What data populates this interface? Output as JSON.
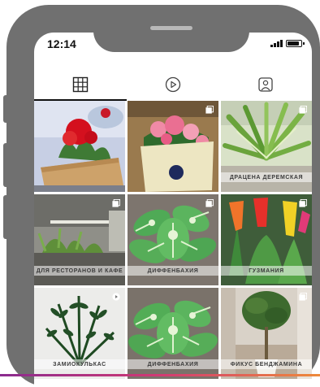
{
  "status_bar": {
    "time": "12:14",
    "battery_level": 0.85
  },
  "tabs": [
    {
      "icon": "grid-icon",
      "active": true
    },
    {
      "icon": "reels-icon",
      "active": false
    },
    {
      "icon": "tagged-icon",
      "active": false
    }
  ],
  "posts": [
    {
      "caption": "",
      "badge": "none"
    },
    {
      "caption": "",
      "badge": "multiple-photos-icon"
    },
    {
      "caption": "ДРАЦЕНА ДЕРЕМСКАЯ",
      "badge": "multiple-photos-icon"
    },
    {
      "caption": "ДЛЯ РЕСТОРАНОВ И КАФЕ",
      "badge": "multiple-photos-icon"
    },
    {
      "caption": "ДИФФЕНБАХИЯ",
      "badge": "multiple-photos-icon"
    },
    {
      "caption": "ГУЗМАНИЯ",
      "badge": "multiple-photos-icon"
    },
    {
      "caption": "ЗАМИОКУЛЬКАС",
      "badge": "video-icon"
    },
    {
      "caption": "ДИФФЕНБАХИЯ",
      "badge": "none"
    },
    {
      "caption": "ФИКУС БЕНДЖАМИНА",
      "badge": "multiple-photos-icon"
    }
  ],
  "colors": {
    "frame": "#707070",
    "accent_gradient": [
      "#8a2b8f",
      "#d23a73",
      "#ee8a3a"
    ]
  }
}
